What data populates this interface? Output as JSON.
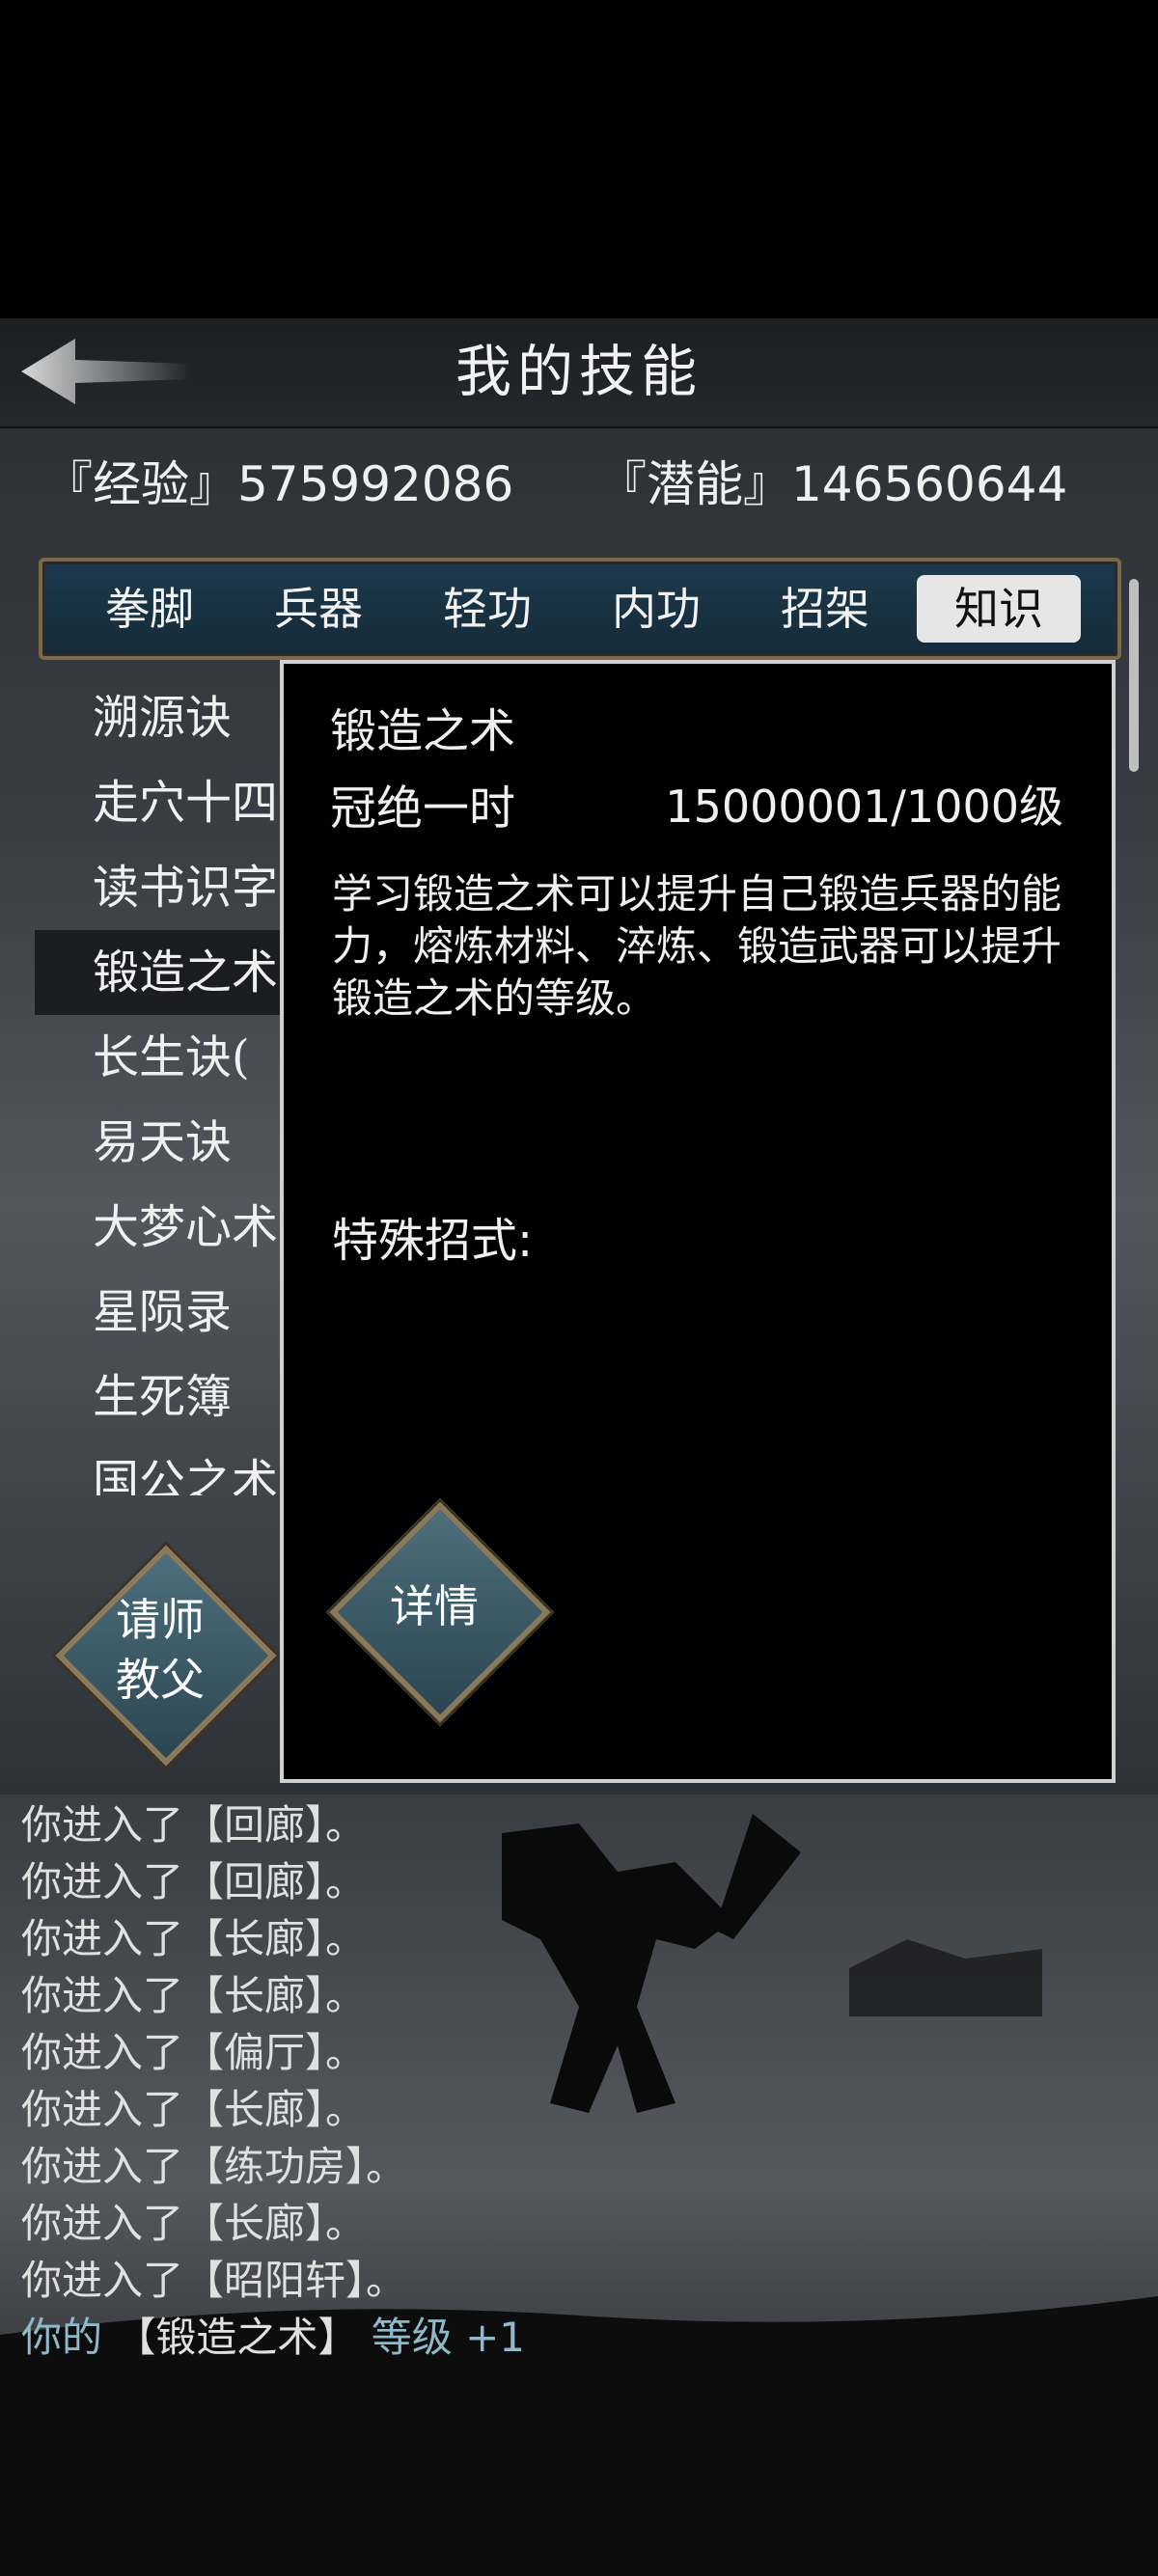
{
  "header": {
    "title": "我的技能",
    "back_icon": "back-arrow-icon"
  },
  "stats": {
    "exp_label": "『经验』575992086",
    "pot_label": "『潜能』146560644"
  },
  "tabs": [
    {
      "label": "拳脚",
      "active": false
    },
    {
      "label": "兵器",
      "active": false
    },
    {
      "label": "轻功",
      "active": false
    },
    {
      "label": "内功",
      "active": false
    },
    {
      "label": "招架",
      "active": false
    },
    {
      "label": "知识",
      "active": true
    }
  ],
  "skills": [
    "溯源诀",
    "走穴十四",
    "读书识字",
    "锻造之术",
    "长生诀(",
    "易天诀",
    "大梦心术",
    "星陨录",
    "生死簿",
    "国公之术"
  ],
  "selected_skill_index": 3,
  "buttons": {
    "teacher": "请师\n教父",
    "detail": "详情"
  },
  "popup": {
    "title": "锻造之术",
    "rank": "冠绝一时",
    "level": "15000001/1000级",
    "description": "学习锻造之术可以提升自己锻造兵器的能力，熔炼材料、淬炼、锻造武器可以提升锻造之术的等级。",
    "special_label": "特殊招式:"
  },
  "log": [
    {
      "text": "你进入了【回廊】。"
    },
    {
      "text": "你进入了【回廊】。"
    },
    {
      "text": "你进入了【长廊】。"
    },
    {
      "text": "你进入了【长廊】。"
    },
    {
      "text": "你进入了【偏厅】。"
    },
    {
      "text": "你进入了【长廊】。"
    },
    {
      "text": "你进入了【练功房】。"
    },
    {
      "text": "你进入了【长廊】。"
    },
    {
      "text": "你进入了【昭阳轩】。"
    }
  ],
  "log_last": {
    "prefix": "你的",
    "skill": "【锻造之术】",
    "suffix": "等级 +1"
  },
  "colors": {
    "accent_cyan": "#8fb8c8",
    "tab_frame": "#7a6a4a",
    "popup_border": "#d0d0d0"
  }
}
